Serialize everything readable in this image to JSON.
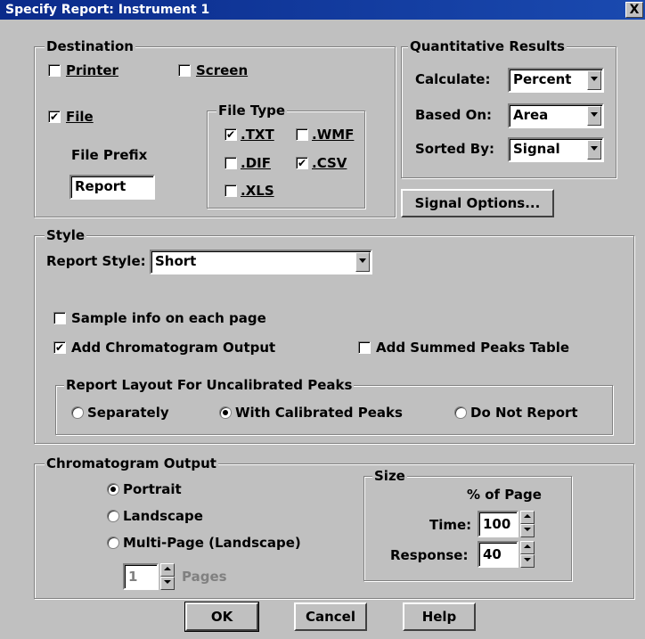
{
  "window": {
    "title": "Specify Report: Instrument 1",
    "close_label": "X"
  },
  "destination": {
    "legend": "Destination",
    "printer": {
      "label": "Printer",
      "checked": false
    },
    "screen": {
      "label": "Screen",
      "checked": false
    },
    "file": {
      "label": "File",
      "checked": true
    },
    "file_prefix_label": "File Prefix",
    "file_prefix_value": "Report",
    "file_type": {
      "legend": "File Type",
      "txt": {
        "label": ".TXT",
        "checked": true
      },
      "wmf": {
        "label": ".WMF",
        "checked": false
      },
      "dif": {
        "label": ".DIF",
        "checked": false
      },
      "csv": {
        "label": ".CSV",
        "checked": true
      },
      "xls": {
        "label": ".XLS",
        "checked": false
      }
    }
  },
  "quant": {
    "legend": "Quantitative Results",
    "calculate_label": "Calculate:",
    "calculate_value": "Percent",
    "based_on_label": "Based On:",
    "based_on_value": "Area",
    "sorted_by_label": "Sorted By:",
    "sorted_by_value": "Signal"
  },
  "signal_options_label": "Signal Options...",
  "style": {
    "legend": "Style",
    "report_style_label": "Report Style:",
    "report_style_value": "Short",
    "sample_info": {
      "label": "Sample info on each page",
      "checked": false
    },
    "add_chrom": {
      "label": "Add Chromatogram Output",
      "checked": true
    },
    "add_summed": {
      "label": "Add Summed Peaks Table",
      "checked": false
    },
    "layout": {
      "legend": "Report Layout For Uncalibrated Peaks",
      "separately": "Separately",
      "with_calibrated": "With Calibrated Peaks",
      "do_not_report": "Do Not Report",
      "selected": "with_calibrated"
    }
  },
  "chrom": {
    "legend": "Chromatogram Output",
    "portrait": "Portrait",
    "landscape": "Landscape",
    "multipage": "Multi-Page (Landscape)",
    "selected": "portrait",
    "pages_value": "1",
    "pages_label": "Pages",
    "size": {
      "legend": "Size",
      "pct_label": "% of Page",
      "time_label": "Time:",
      "time_value": "100",
      "response_label": "Response:",
      "response_value": "40"
    }
  },
  "buttons": {
    "ok": "OK",
    "cancel": "Cancel",
    "help": "Help"
  }
}
